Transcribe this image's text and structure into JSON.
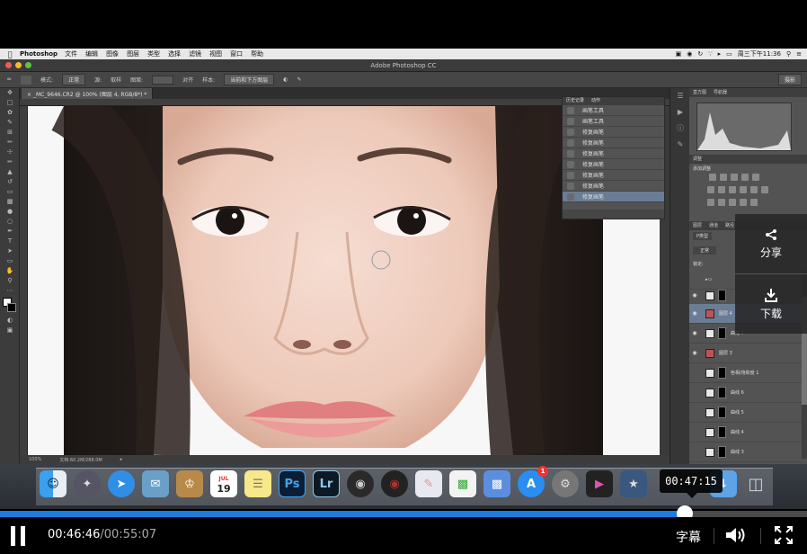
{
  "menubar": {
    "app_name": "Photoshop",
    "items": [
      "文件",
      "编辑",
      "图像",
      "图层",
      "类型",
      "选择",
      "滤镜",
      "视图",
      "窗口",
      "帮助"
    ],
    "clock": "周三下午11:36"
  },
  "window": {
    "title": "Adobe Photoshop CC"
  },
  "options_bar": {
    "mode_label": "模式:",
    "mode_value": "正常",
    "source_label": "源:",
    "source_sample": "取样",
    "source_pattern": "图案:",
    "align_label": "对齐",
    "sample_label": "样本:",
    "sample_value": "当前和下方图层",
    "workspace": "摄影"
  },
  "document": {
    "tab_label": "_MC_9646.CR2 @ 100% (图层 4, RGB/8*) *",
    "status_zoom": "100%",
    "status_doc": "文档:60.2M/288.0M"
  },
  "history": {
    "tabs": [
      "历史记录",
      "动作"
    ],
    "items": [
      "画笔工具",
      "画笔工具",
      "修复画笔",
      "修复画笔",
      "修复画笔",
      "修复画笔",
      "修复画笔",
      "修复画笔",
      "修复画笔"
    ]
  },
  "right_panel": {
    "histogram_tabs": [
      "直方图",
      "导航器"
    ],
    "adjust_tab": "调整",
    "adjust_title": "添加调整",
    "layers_tabs": [
      "图层",
      "通道",
      "路径"
    ],
    "filter_label": "P类型",
    "blend_mode": "正常",
    "lock_label": "锁定:",
    "layers": [
      {
        "name": "",
        "thumb": "folder"
      },
      {
        "name": "",
        "thumb": "mask"
      },
      {
        "name": "图层 4",
        "thumb": "photo"
      },
      {
        "name": "曲线 7",
        "thumb": "mask"
      },
      {
        "name": "图层 3",
        "thumb": "photo"
      },
      {
        "name": "色相/饱和度 1",
        "thumb": "mask"
      },
      {
        "name": "曲线 6",
        "thumb": "mask"
      },
      {
        "name": "曲线 5",
        "thumb": "mask"
      },
      {
        "name": "曲线 4",
        "thumb": "mask"
      },
      {
        "name": "曲线 3",
        "thumb": "mask"
      }
    ]
  },
  "overlay": {
    "share_label": "分享",
    "download_label": "下载"
  },
  "dock": {
    "calendar_day": "19",
    "calendar_month": "JUL",
    "ps_label": "Ps",
    "lr_label": "Lr",
    "appstore_badge": "1"
  },
  "player": {
    "tooltip_time": "00:47:15",
    "current_time": "00:46:46",
    "total_time": "/00:55:07",
    "subtitles_label": "字幕",
    "progress_fraction": 0.848
  },
  "colors": {
    "accent": "#1a7de0",
    "history_active": "#6b7d95"
  }
}
